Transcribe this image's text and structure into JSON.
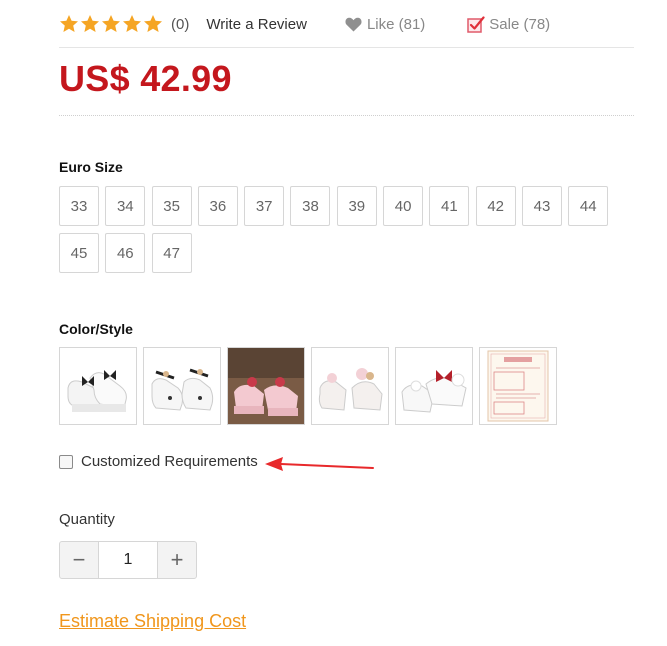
{
  "rating": {
    "stars": 5,
    "star_color": "#f5a524",
    "count_text": "(0)",
    "write_review": "Write a Review"
  },
  "like": {
    "label": "Like (81)",
    "icon": "heart-icon",
    "color": "#888888"
  },
  "sale": {
    "label": "Sale (78)",
    "icon": "checkbox-check-icon",
    "color": "#e05a6a"
  },
  "price": {
    "text": "US$ 42.99",
    "color": "#c4171d"
  },
  "euro_size": {
    "label": "Euro Size",
    "options": [
      "33",
      "34",
      "35",
      "36",
      "37",
      "38",
      "39",
      "40",
      "41",
      "42",
      "43",
      "44",
      "45",
      "46",
      "47"
    ]
  },
  "color_style": {
    "label": "Color/Style",
    "options": [
      "white-shoes-black-bows",
      "white-shoes-black-strap",
      "pink-shoes-photo",
      "white-shoes-pink-bow",
      "white-shoes-red-bow",
      "customization-notice-card"
    ]
  },
  "customized": {
    "label": "Customized Requirements",
    "checked": false,
    "arrow_color": "#e8292b"
  },
  "quantity": {
    "label": "Quantity",
    "value": "1",
    "minus": "−",
    "plus": "+"
  },
  "estimate_shipping": {
    "text": "Estimate Shipping Cost",
    "color": "#f0961c"
  }
}
